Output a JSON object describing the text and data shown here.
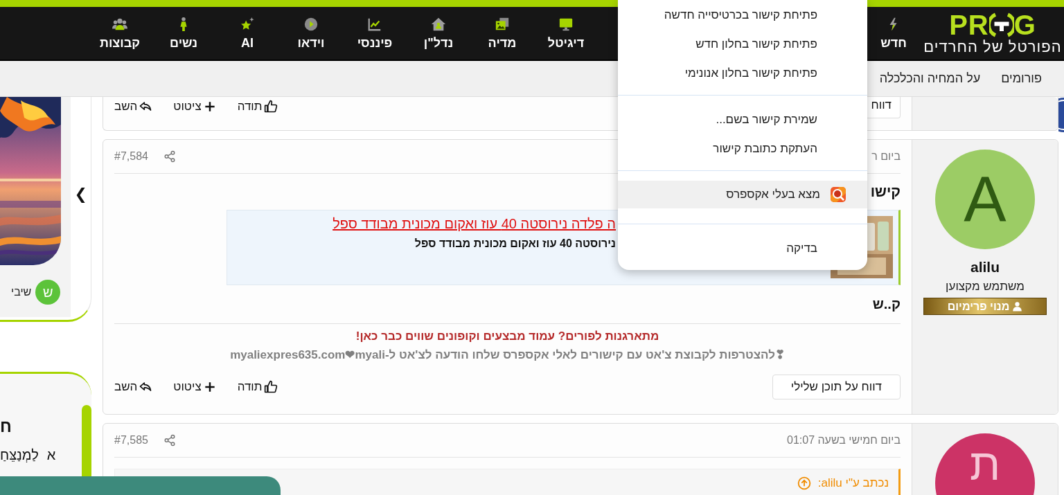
{
  "header": {
    "logo_left": "PR",
    "logo_right": "G",
    "tagline": "הפורטל של החרדים",
    "nav": [
      {
        "kind": "bolt",
        "label": "חדש"
      },
      {
        "kind": "monitor",
        "label": "דיגיטל"
      },
      {
        "kind": "media",
        "label": "מדיה"
      },
      {
        "kind": "house",
        "label": "נדל\"ן"
      },
      {
        "kind": "chart",
        "label": "פיננסי"
      },
      {
        "kind": "play",
        "label": "וידאו"
      },
      {
        "kind": "sparkle",
        "label": "AI"
      },
      {
        "kind": "woman",
        "label": "נשים"
      },
      {
        "kind": "group",
        "label": "קבוצות"
      }
    ]
  },
  "subnav": [
    "פורומים",
    "על המחיה והכלכלה"
  ],
  "posts": [
    {
      "report": "דווח",
      "actions": [
        {
          "kind": "like",
          "label": "תודה"
        },
        {
          "kind": "quote",
          "label": "ציטוט"
        },
        {
          "kind": "reply",
          "label": "השב"
        }
      ]
    },
    {
      "user": {
        "avatar_letter": "A",
        "color": "#9ccc65",
        "name": "alilu",
        "title": "משתמש מקצוען",
        "badge": "מנוי פרימיום"
      },
      "date": "ביום ר",
      "number": "#7,584",
      "title": "קישו",
      "preview": {
        "link": "ה פלדה נירוסטה 40 עוז ואקום מכונית מבודד ספל",
        "subtitle": "נירוסטה 40 עוז ואקום מכונית מבודד ספל"
      },
      "text": "ק..ש",
      "promo": "מתארגנות לפורים? עמוד מבצעים וקופונים שווים כבר כאן!",
      "invite": "❣להצטרפות לקבוצת צ'אט עם קישורים לאלי אקספרס שלחו הודעה לצ'אט ל-myaliexpres635.com❤myali",
      "report": "דווח על תוכן שלילי",
      "actions": [
        {
          "kind": "like",
          "label": "תודה"
        },
        {
          "kind": "quote",
          "label": "ציטוט"
        },
        {
          "kind": "reply",
          "label": "השב"
        }
      ]
    },
    {
      "user": {
        "avatar_letter": "ת",
        "color": "#cc3366"
      },
      "date": "ביום חמישי בשעה 01:07",
      "number": "#7,585",
      "quote": "נכתב ע\"י alilu:"
    }
  ],
  "sidebar": {
    "chevron": "❮",
    "avatar_letter": "ש",
    "author": "שיבי",
    "heading": "ח",
    "verse_number": "א",
    "verse": "לַמְנַצֵּחַ"
  },
  "menu": {
    "items": [
      {
        "kind": "item",
        "label": "פתיחת קישור בכרטיסייה חדשה",
        "selected": false
      },
      {
        "kind": "item",
        "label": "פתיחת קישור בחלון חדש",
        "selected": false
      },
      {
        "kind": "item",
        "label": "פתיחת קישור בחלון אנונימי",
        "selected": false
      },
      {
        "kind": "separator"
      },
      {
        "kind": "item",
        "label": "שמירת קישור בשם...",
        "selected": false
      },
      {
        "kind": "item",
        "label": "העתקת כתובת קישור",
        "selected": false
      },
      {
        "kind": "separator"
      },
      {
        "kind": "extension",
        "label": "מצא בעלי אקספרס",
        "selected": true
      },
      {
        "kind": "separator"
      },
      {
        "kind": "item",
        "label": "בדיקה",
        "selected": false
      }
    ]
  }
}
